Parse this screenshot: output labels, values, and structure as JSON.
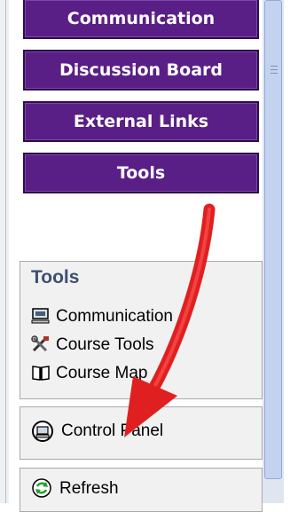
{
  "nav": {
    "buttons": [
      {
        "label": "Communication"
      },
      {
        "label": "Discussion Board"
      },
      {
        "label": "External Links"
      },
      {
        "label": "Tools"
      }
    ]
  },
  "tools_panel": {
    "title": "Tools",
    "items": [
      {
        "label": "Communication",
        "icon": "monitor-icon"
      },
      {
        "label": "Course Tools",
        "icon": "tools-icon"
      },
      {
        "label": "Course Map",
        "icon": "book-icon"
      }
    ]
  },
  "control_panel": {
    "label": "Control Panel",
    "icon": "control-panel-icon"
  },
  "refresh": {
    "label": "Refresh",
    "icon": "refresh-icon"
  },
  "colors": {
    "nav_button": "#5a1f86",
    "arrow": "#e02020",
    "title": "#3f4f74"
  }
}
